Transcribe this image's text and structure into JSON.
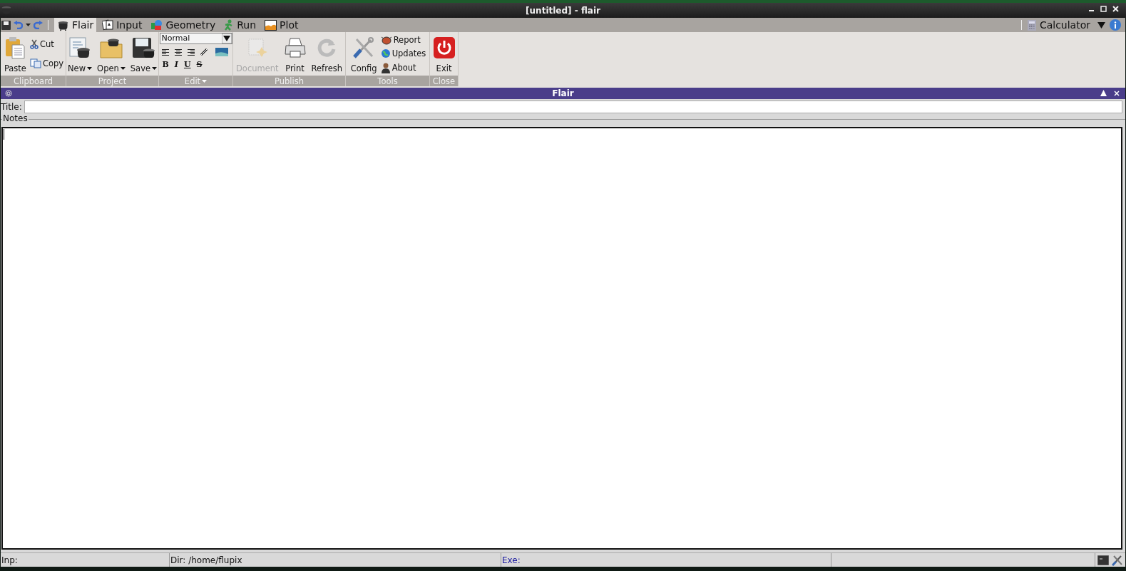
{
  "window": {
    "title": "[untitled] - flair"
  },
  "tabs": [
    {
      "label": "Flair",
      "selected": true
    },
    {
      "label": "Input",
      "selected": false
    },
    {
      "label": "Geometry",
      "selected": false
    },
    {
      "label": "Run",
      "selected": false
    },
    {
      "label": "Plot",
      "selected": false
    }
  ],
  "tool_menu": {
    "label": "Calculator"
  },
  "ribbon": {
    "groups": [
      {
        "kind": "buttons",
        "label": "Clipboard",
        "dropdown": false,
        "items": [
          {
            "kind": "large",
            "label": "Paste",
            "disabled": false,
            "dropdown": false
          },
          {
            "kind": "small",
            "label": "Cut",
            "disabled": false,
            "dropdown": false
          },
          {
            "kind": "small",
            "label": "Copy",
            "disabled": false,
            "dropdown": false
          }
        ]
      },
      {
        "kind": "buttons",
        "label": "Project",
        "dropdown": false,
        "items": [
          {
            "kind": "large",
            "label": "New",
            "disabled": false,
            "dropdown": true
          },
          {
            "kind": "large",
            "label": "Open",
            "disabled": false,
            "dropdown": true
          },
          {
            "kind": "large",
            "label": "Save",
            "disabled": false,
            "dropdown": true
          }
        ]
      },
      {
        "kind": "edit",
        "label": "Edit",
        "dropdown": true,
        "style": "Normal",
        "format": [
          "B",
          "I",
          "U",
          "S"
        ]
      },
      {
        "kind": "buttons",
        "label": "Publish",
        "dropdown": false,
        "items": [
          {
            "kind": "large",
            "label": "Document",
            "disabled": true,
            "dropdown": false
          },
          {
            "kind": "large",
            "label": "Print",
            "disabled": false,
            "dropdown": false
          },
          {
            "kind": "large",
            "label": "Refresh",
            "disabled": false,
            "dropdown": false
          }
        ]
      },
      {
        "kind": "buttons",
        "label": "Tools",
        "dropdown": false,
        "items": [
          {
            "kind": "large",
            "label": "Config",
            "disabled": false,
            "dropdown": false
          },
          {
            "kind": "small",
            "label": "Report",
            "disabled": false,
            "dropdown": false
          },
          {
            "kind": "small",
            "label": "Updates",
            "disabled": false,
            "dropdown": false
          },
          {
            "kind": "small",
            "label": "About",
            "disabled": false,
            "dropdown": false
          }
        ]
      },
      {
        "kind": "buttons",
        "label": "Close",
        "dropdown": false,
        "items": [
          {
            "kind": "large",
            "label": "Exit",
            "disabled": false,
            "dropdown": false
          }
        ]
      }
    ]
  },
  "panel": {
    "title": "Flair",
    "title_label": "Title:",
    "notes_label": "Notes"
  },
  "status_bar": [
    "Inp:",
    "Dir: /home/flupix",
    "Exe:"
  ]
}
